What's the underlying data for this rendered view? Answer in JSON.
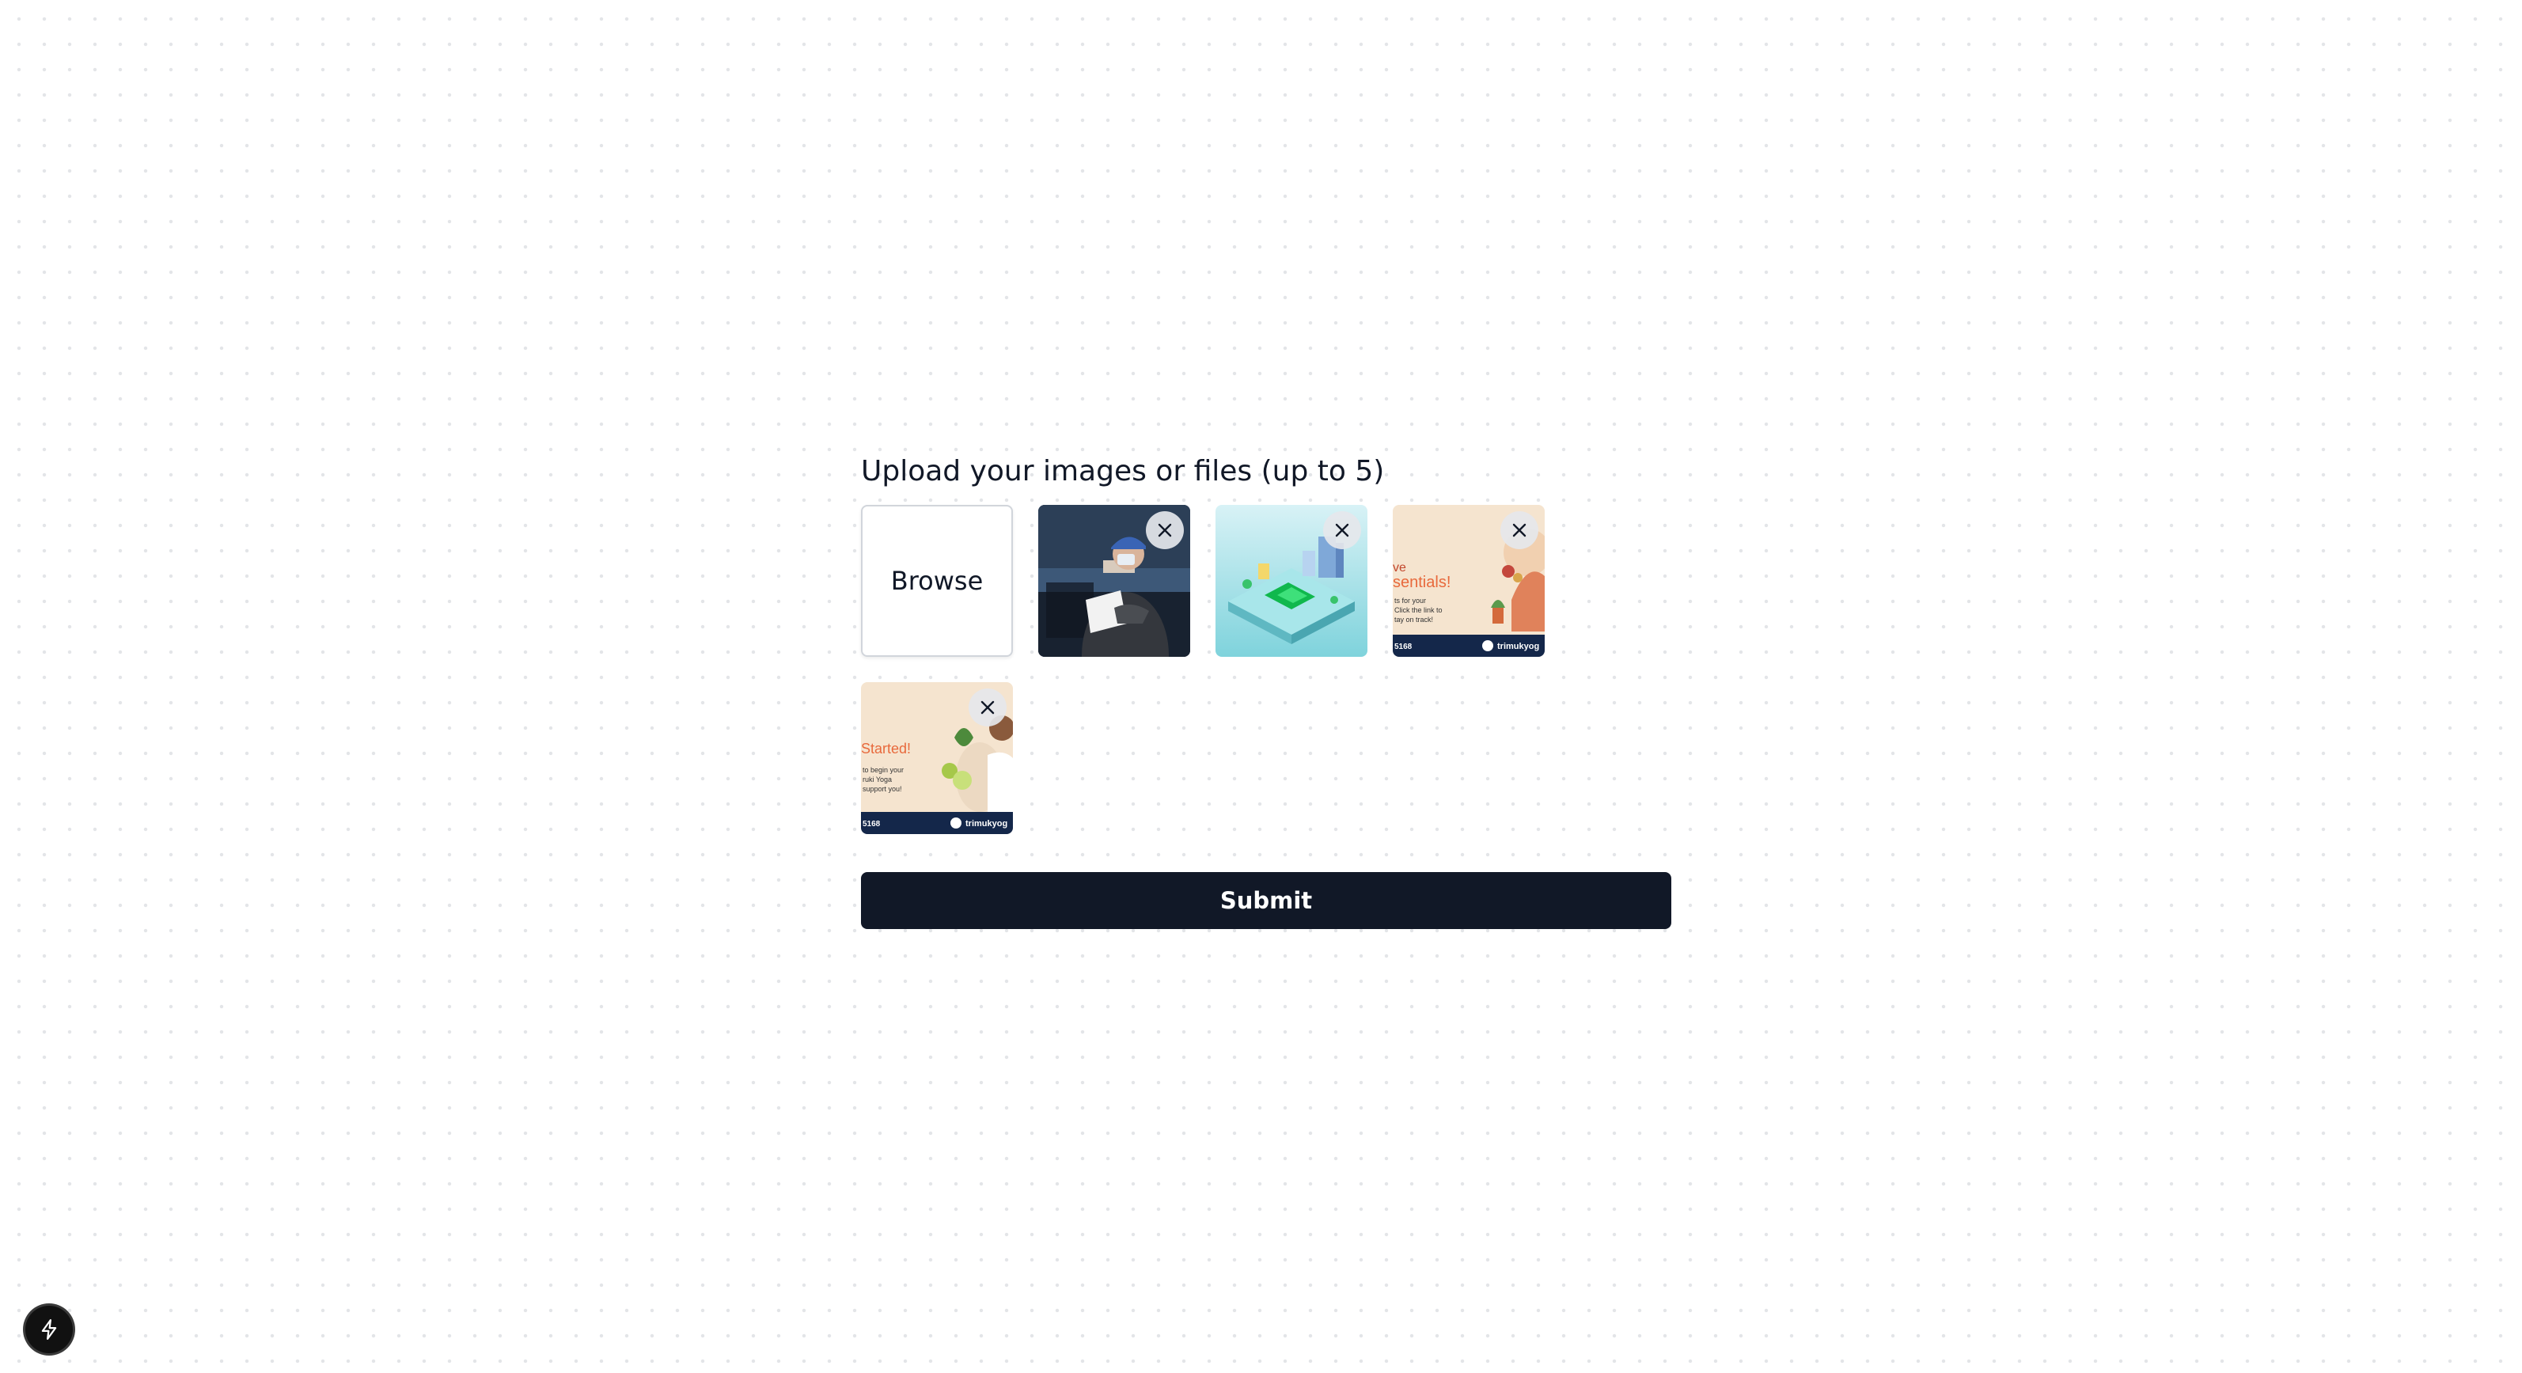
{
  "upload": {
    "title": "Upload your images or files (up to 5)",
    "browse_label": "Browse",
    "files": [
      {
        "subject": "worker-with-clipboard-photo"
      },
      {
        "subject": "isometric-city-phone-illustration"
      },
      {
        "subject": "yoga-essentials-banner",
        "texts": [
          "ve",
          "sentials!",
          "ts for your",
          "Click the link to",
          "tay on track!",
          "5168",
          "trimukyog"
        ]
      },
      {
        "subject": "yoga-get-started-banner",
        "texts": [
          "Started!",
          "to begin your",
          "ruki Yoga",
          "support you!",
          "5168",
          "trimukyog"
        ]
      }
    ]
  },
  "submit_label": "Submit",
  "colors": {
    "primary": "#111827",
    "border": "#d1d5db",
    "remove_bg": "#e5e7eb",
    "banner_orange": "#e8693c",
    "banner_navy": "#14274a"
  },
  "icons": {
    "remove": "close-icon",
    "dev_tools": "lightning-icon"
  }
}
